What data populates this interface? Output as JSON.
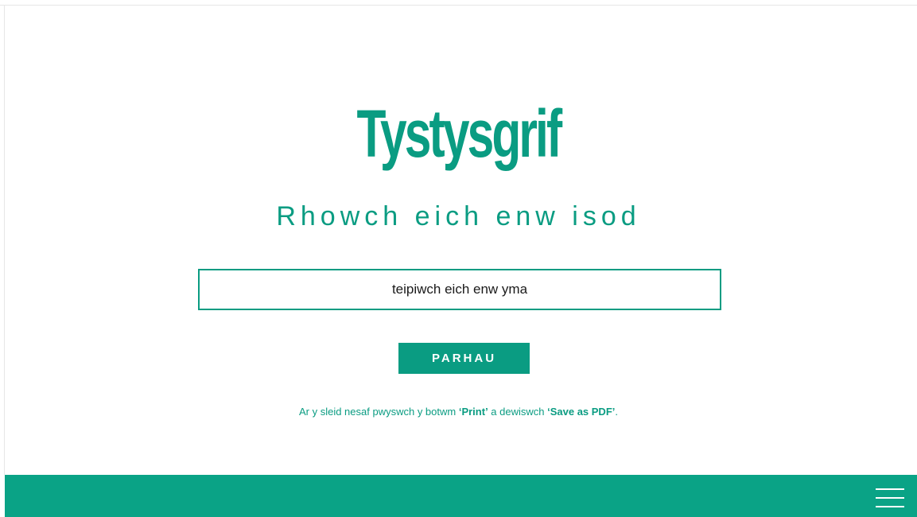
{
  "page": {
    "title": "Tystysgrif",
    "subtitle": "Rhowch eich enw isod"
  },
  "name_input": {
    "placeholder": "teipiwch eich enw yma",
    "value": ""
  },
  "continue_button": {
    "label": "PARHAU"
  },
  "instructions": {
    "text_before": "Ar y sleid nesaf pwyswch y botwm ",
    "print_label": "‘Print’",
    "text_middle": " a dewiswch ",
    "save_label": "‘Save as PDF’",
    "text_after": "."
  },
  "footer": {
    "menu_icon": "hamburger-menu-icon"
  },
  "colors": {
    "accent": "#0a9c82",
    "footer": "#0aa386",
    "background": "#ffffff"
  }
}
